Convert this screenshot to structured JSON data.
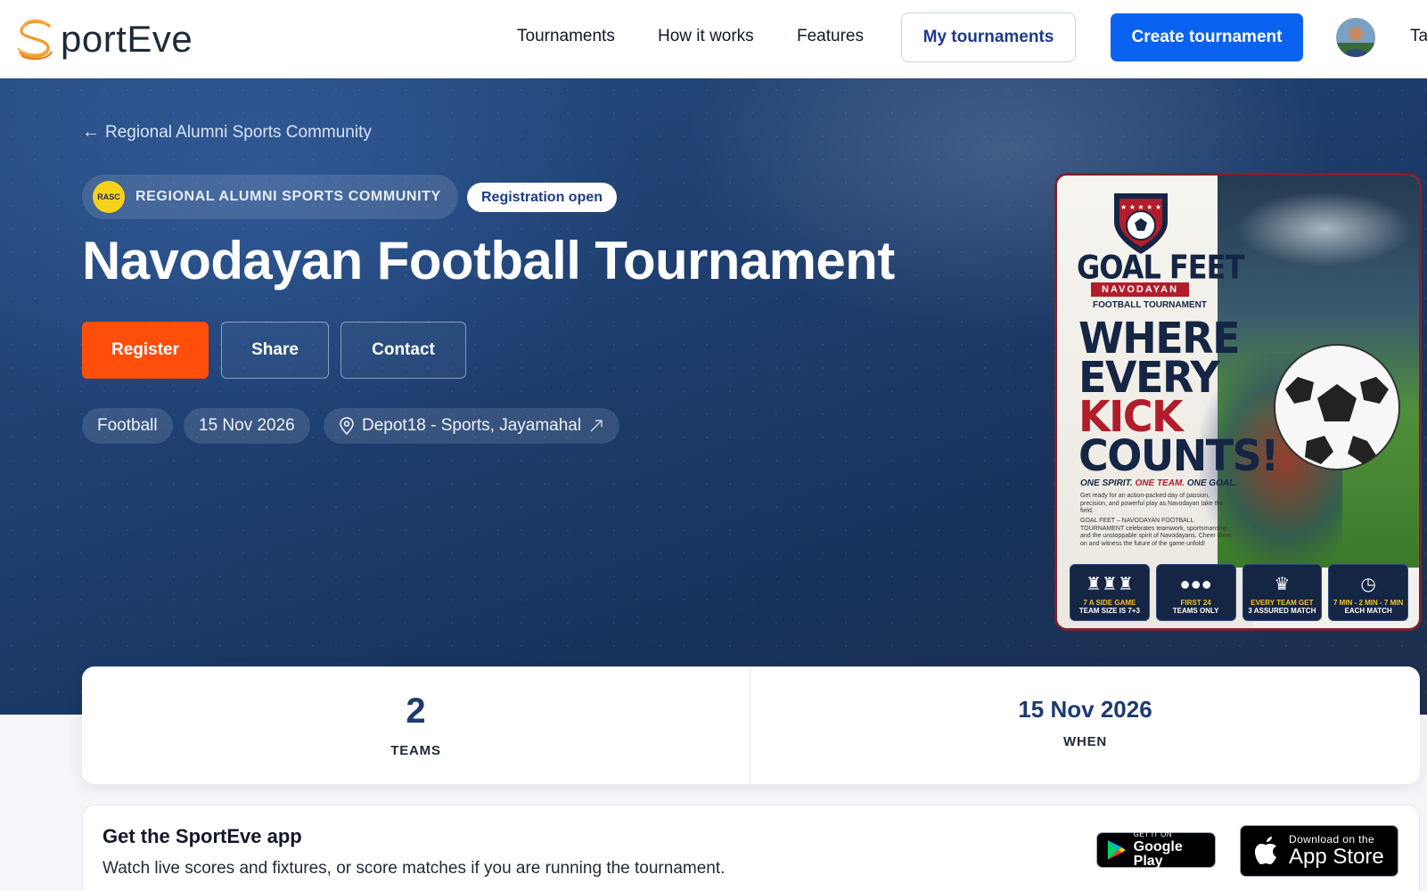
{
  "nav": {
    "brand_initial": "S",
    "brand_rest": "portEve",
    "links": [
      "Tournaments",
      "How it works",
      "Features"
    ],
    "my_tournaments": "My tournaments",
    "create_tournament": "Create tournament",
    "user_initials": "Ta"
  },
  "hero": {
    "back_label": "Regional Alumni Sports Community",
    "org_name": "REGIONAL ALUMNI SPORTS COMMUNITY",
    "org_logo_text": "RASC",
    "status_badge": "Registration open",
    "title": "Navodayan Football Tournament",
    "buttons": {
      "register": "Register",
      "share": "Share",
      "contact": "Contact"
    },
    "meta": {
      "sport": "Football",
      "date": "15 Nov 2026",
      "venue": "Depot18 - Sports, Jayamahal"
    }
  },
  "poster": {
    "goal_feet": "GOAL FEET",
    "navodayan": "NAVODAYAN",
    "subtitle": "FOOTBALL TOURNAMENT",
    "line1": "WHERE",
    "line2": "EVERY",
    "line3": "KICK",
    "line4": "COUNTS!",
    "spirit_a": "ONE SPIRIT.",
    "spirit_b": "ONE TEAM.",
    "spirit_c": "ONE GOAL.",
    "para1": "Get ready for an action-packed day of passion, precision, and powerful play as Navodayan take the field.",
    "para2": "GOAL FEET – NAVODAYAN FOOTBALL TOURNAMENT celebrates teamwork, sportsmanship, and the unstoppable spirit of Navodayans. Cheer them on and witness the future of the game unfold!",
    "cards": [
      {
        "icon": "players-icon",
        "a": "7 A SIDE GAME",
        "b": "TEAM SIZE IS 7+3"
      },
      {
        "icon": "group-icon",
        "a": "FIRST 24",
        "b": "TEAMS ONLY"
      },
      {
        "icon": "trophy-icon",
        "a": "EVERY TEAM GET",
        "b": "3 ASSURED MATCH"
      },
      {
        "icon": "stopwatch-icon",
        "a": "7 MIN - 2 MIN - 7 MIN",
        "b": "EACH MATCH"
      }
    ]
  },
  "stats": {
    "teams_value": "2",
    "teams_label": "TEAMS",
    "when_value": "15 Nov 2026",
    "when_label": "WHEN"
  },
  "app_promo": {
    "title": "Get the SportEve app",
    "subtitle": "Watch live scores and fixtures, or score matches if you are running the tournament.",
    "google_small": "GET IT ON",
    "google_big": "Google Play",
    "apple_small": "Download on the",
    "apple_big": "App Store"
  },
  "colors": {
    "primary_blue": "#0a63f0",
    "register_orange": "#ff4d0a",
    "hero_navy": "#1c3c6c",
    "stat_navy": "#1e3a6e"
  }
}
